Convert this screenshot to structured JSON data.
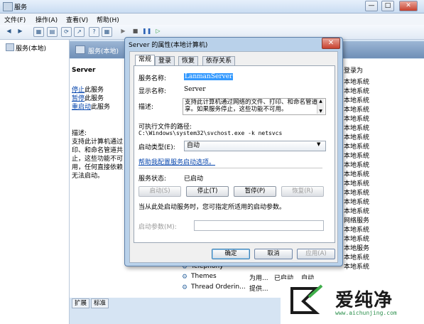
{
  "window": {
    "title": "服务",
    "min": "—",
    "max": "□",
    "close": "✕"
  },
  "menu": [
    "文件(F)",
    "操作(A)",
    "查看(V)",
    "帮助(H)"
  ],
  "toolbar": [
    "◀",
    "▶",
    "▦",
    "▤",
    "⟳",
    "↗",
    "?",
    "▦",
    "▶",
    "■",
    "❚❚",
    "▷"
  ],
  "tree": {
    "label": "服务(本地)"
  },
  "panel": {
    "header": "服务(本地)",
    "service_title": "Server",
    "links": [
      "停止",
      "暂停",
      "重启动"
    ],
    "link_suffix": "此服务",
    "desc_label": "描述:",
    "desc_lines": [
      "支持此计算机通过",
      "印、和命名管道共",
      "止，这些功能不可",
      "用，任何直接依赖",
      "无法启动。"
    ]
  },
  "right_column": {
    "header": "登录为",
    "rows": [
      "本地系统",
      "本地系统",
      "本地系统",
      "本地系统",
      "本地系统",
      "本地系统",
      "本地系统",
      "本地系统",
      "本地系统",
      "本地系统",
      "本地系统",
      "本地系统",
      "本地系统",
      "本地系统",
      "本地系统",
      "网络服务",
      "本地系统",
      "本地系统",
      "本地服务",
      "本地系统",
      "本地系统"
    ]
  },
  "list_rows": [
    {
      "name": "Telephony",
      "desc": "",
      "status": "",
      "start": "",
      "logon": ""
    },
    {
      "name": "Themes",
      "desc": "为用...",
      "status": "已启动",
      "start": "自动",
      "logon": ""
    },
    {
      "name": "Thread Orderin...",
      "desc": "提供...",
      "status": "",
      "start": "",
      "logon": ""
    }
  ],
  "bottom_tabs": [
    "扩展",
    "标准"
  ],
  "dialog": {
    "title": "Server 的属性(本地计算机)",
    "close": "✕",
    "tabs": [
      "常规",
      "登录",
      "恢复",
      "依存关系"
    ],
    "svc_name_label": "服务名称:",
    "svc_name_value": "LanmanServer",
    "display_name_label": "显示名称:",
    "display_name_value": "Server",
    "desc_label": "描述:",
    "desc_value": "支持此计算机通过网络的文件、打印、和命名管道共享。如果服务停止，这些功能不可用。",
    "path_label": "可执行文件的路径:",
    "path_value": "C:\\Windows\\system32\\svchost.exe -k netsvcs",
    "startup_label": "启动类型(E):",
    "startup_value": "自动",
    "help_link": "帮助我配置服务启动选项。",
    "status_label": "服务状态:",
    "status_value": "已启动",
    "btn_start": "启动(S)",
    "btn_stop": "停止(T)",
    "btn_pause": "暂停(P)",
    "btn_resume": "恢复(R)",
    "hint": "当从此处启动服务时，您可指定所适用的启动参数。",
    "param_label": "启动参数(M):",
    "param_value": "",
    "ok": "确定",
    "cancel": "取消",
    "apply": "应用(A)"
  },
  "watermark": {
    "text": "爱纯净",
    "url": "www.aichunjing.com"
  }
}
